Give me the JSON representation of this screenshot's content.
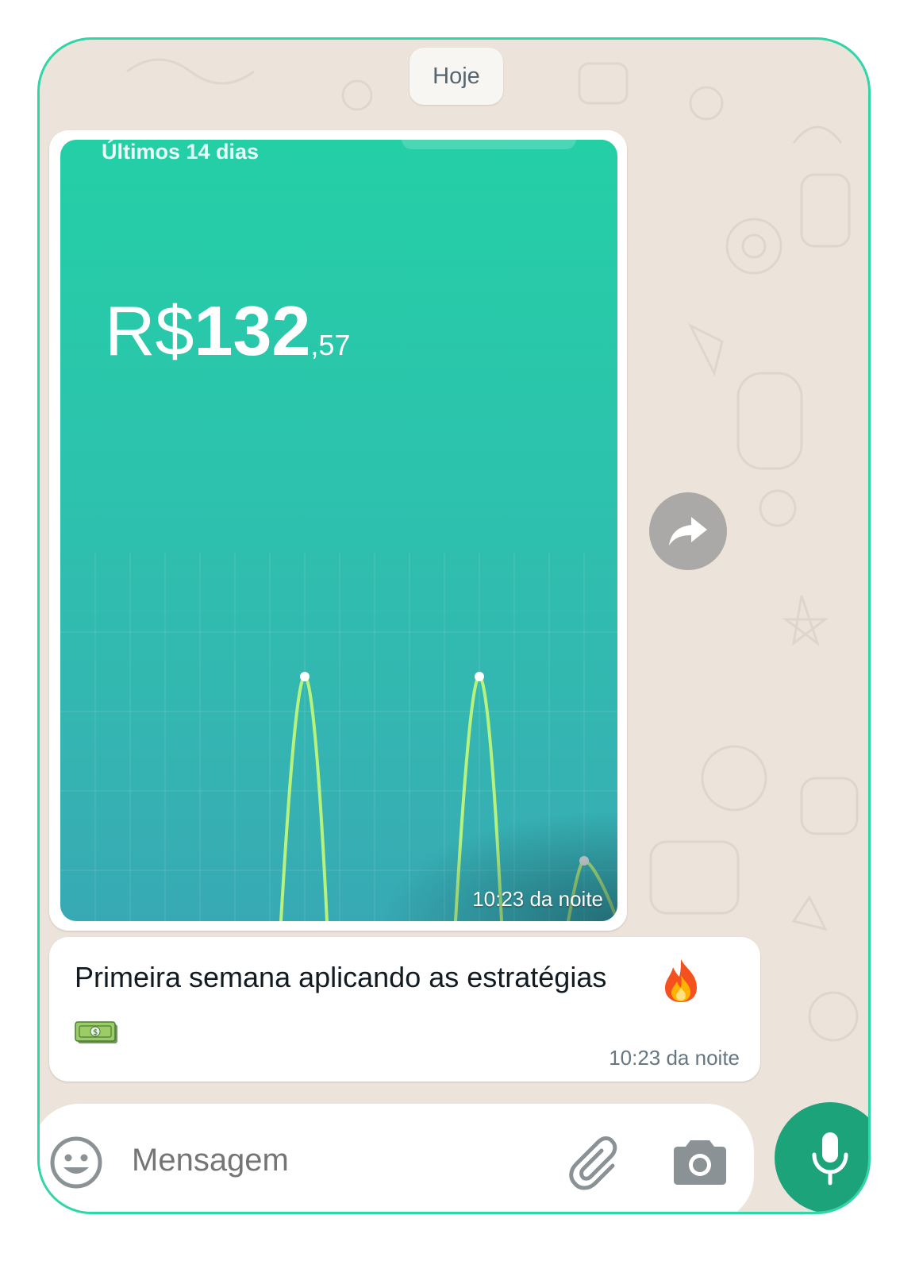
{
  "date_chip": "Hoje",
  "image_message": {
    "period_label": "Últimos 14 dias",
    "currency": "R$",
    "amount_integer": "132",
    "amount_decimal": ",57",
    "time": "10:23 da noite"
  },
  "text_message": {
    "text": "Primeira semana aplicando as estratégias",
    "emojis": [
      "fire-icon",
      "money-icon"
    ],
    "time": "10:23 da noite"
  },
  "input": {
    "placeholder": "Mensagem"
  },
  "icons": {
    "forward": "forward-icon",
    "emoji": "emoji-icon",
    "attach": "paperclip-icon",
    "camera": "camera-icon",
    "mic": "microphone-icon"
  },
  "colors": {
    "frame_border": "#2fd6a8",
    "chat_background": "#ece4da",
    "card_gradient_top": "#24cfa6",
    "card_gradient_bottom": "#37a9b3",
    "line": "#b7f27c",
    "mic_button": "#1da37a"
  }
}
